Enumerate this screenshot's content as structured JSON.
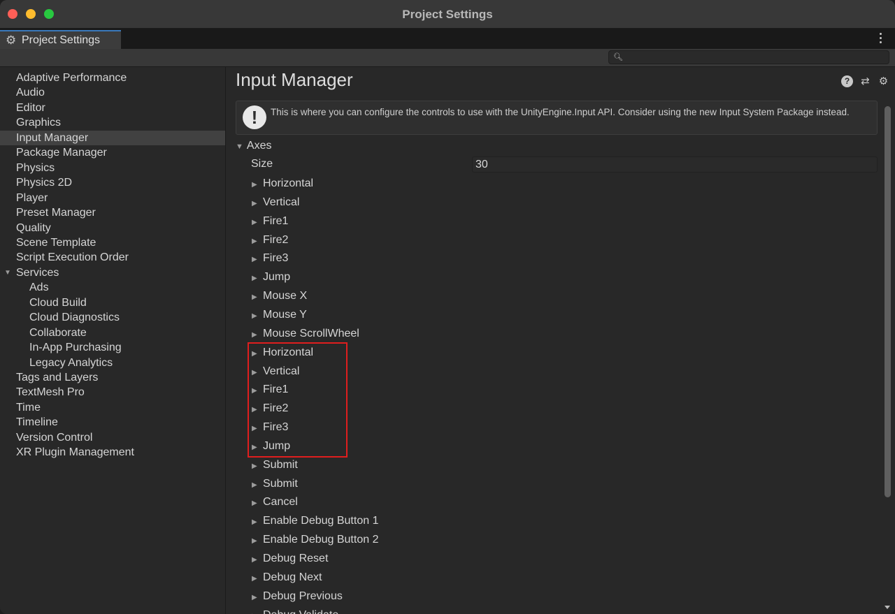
{
  "window": {
    "title": "Project Settings"
  },
  "tab": {
    "label": "Project Settings",
    "icon": "gear-icon"
  },
  "search": {
    "placeholder": "",
    "value": ""
  },
  "sidebar": {
    "items": [
      {
        "label": "Adaptive Performance",
        "sub": false
      },
      {
        "label": "Audio",
        "sub": false
      },
      {
        "label": "Editor",
        "sub": false
      },
      {
        "label": "Graphics",
        "sub": false
      },
      {
        "label": "Input Manager",
        "sub": false,
        "selected": true
      },
      {
        "label": "Package Manager",
        "sub": false
      },
      {
        "label": "Physics",
        "sub": false
      },
      {
        "label": "Physics 2D",
        "sub": false
      },
      {
        "label": "Player",
        "sub": false
      },
      {
        "label": "Preset Manager",
        "sub": false
      },
      {
        "label": "Quality",
        "sub": false
      },
      {
        "label": "Scene Template",
        "sub": false
      },
      {
        "label": "Script Execution Order",
        "sub": false
      },
      {
        "label": "Services",
        "sub": false,
        "expanded": true
      },
      {
        "label": "Ads",
        "sub": true
      },
      {
        "label": "Cloud Build",
        "sub": true
      },
      {
        "label": "Cloud Diagnostics",
        "sub": true
      },
      {
        "label": "Collaborate",
        "sub": true
      },
      {
        "label": "In-App Purchasing",
        "sub": true
      },
      {
        "label": "Legacy Analytics",
        "sub": true
      },
      {
        "label": "Tags and Layers",
        "sub": false
      },
      {
        "label": "TextMesh Pro",
        "sub": false
      },
      {
        "label": "Time",
        "sub": false
      },
      {
        "label": "Timeline",
        "sub": false
      },
      {
        "label": "Version Control",
        "sub": false
      },
      {
        "label": "XR Plugin Management",
        "sub": false
      }
    ]
  },
  "main": {
    "title": "Input Manager",
    "header_icons": [
      "help-icon",
      "sliders-icon",
      "gear-icon"
    ],
    "help_text": "This is where you can configure the controls to use with the UnityEngine.Input API. Consider using the new Input System Package instead.",
    "axes_label": "Axes",
    "size_label": "Size",
    "size_value": "30",
    "axes": [
      "Horizontal",
      "Vertical",
      "Fire1",
      "Fire2",
      "Fire3",
      "Jump",
      "Mouse X",
      "Mouse Y",
      "Mouse ScrollWheel",
      "Horizontal",
      "Vertical",
      "Fire1",
      "Fire2",
      "Fire3",
      "Jump",
      "Submit",
      "Submit",
      "Cancel",
      "Enable Debug Button 1",
      "Enable Debug Button 2",
      "Debug Reset",
      "Debug Next",
      "Debug Previous",
      "Debug Validate"
    ]
  },
  "colors": {
    "highlight": "#e01e1e",
    "tab_accent": "#3a79bb"
  }
}
